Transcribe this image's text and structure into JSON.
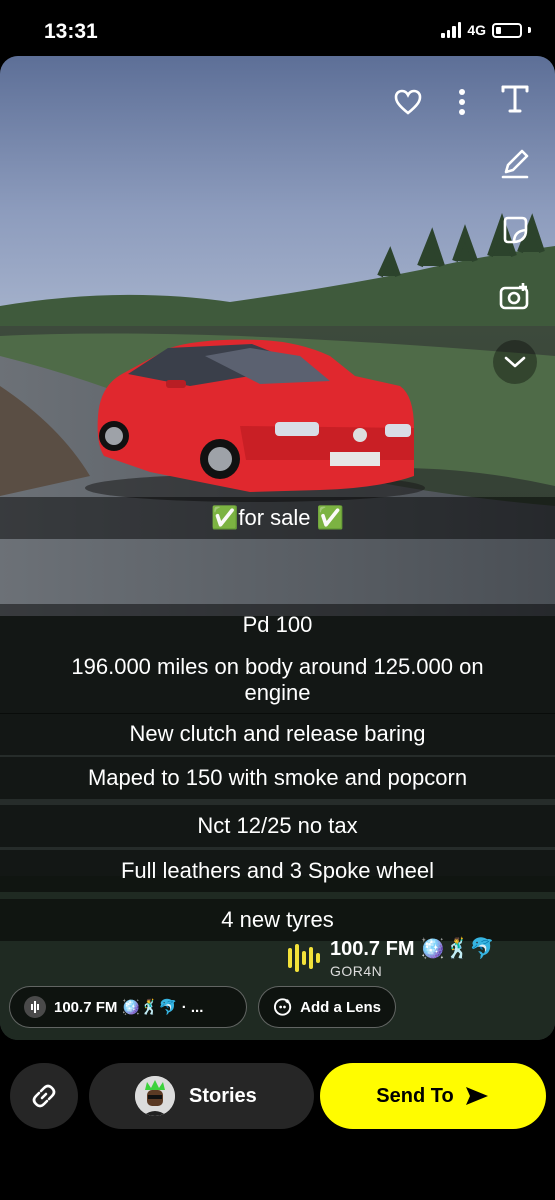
{
  "status": {
    "time": "13:31",
    "network": "4G"
  },
  "snap": {
    "captions": [
      "✅for sale ✅",
      "Pd 100",
      "196.000 miles on body around 125.000 on engine",
      "New clutch and release baring",
      "Maped to 150 with smoke and popcorn",
      "Nct 12/25 no tax",
      "Full leathers and 3 Spoke wheel",
      "4 new tyres"
    ],
    "tools": [
      "heart-icon",
      "more-icon",
      "text-icon",
      "pencil-icon",
      "sticker-icon",
      "camera-timer-icon",
      "chevron-down-icon"
    ],
    "music_sticker": {
      "title": "100.7 FM 🪩🕺🐬",
      "artist": "GOR4N"
    },
    "sound_chip": {
      "label": "100.7 FM 🪩🕺🐬 · ..."
    },
    "lens_chip": {
      "label": "Add a Lens"
    }
  },
  "bottom_bar": {
    "stories_label": "Stories",
    "send_label": "Send To"
  },
  "colors": {
    "send_yellow": "#fffc00",
    "pill_gray": "#262626",
    "car_red": "#e0282e"
  }
}
